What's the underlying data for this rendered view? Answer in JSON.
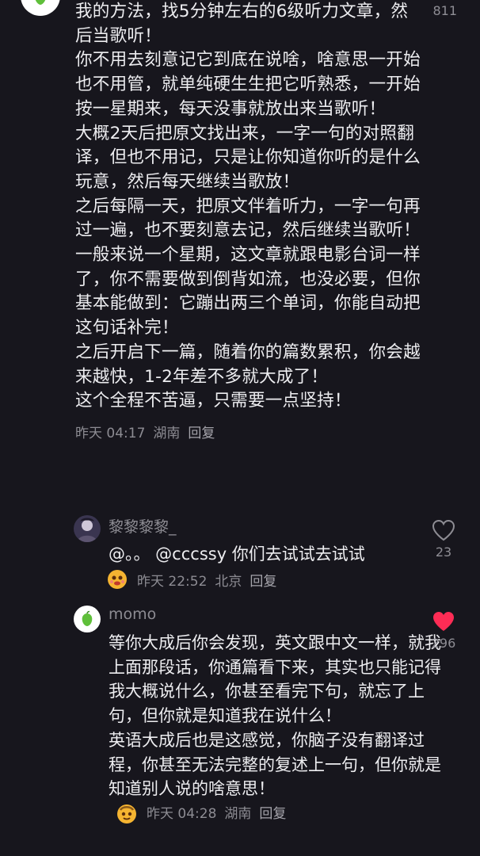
{
  "top": {
    "like_count": "811"
  },
  "main_comment": {
    "paragraphs": [
      "我的方法，找5分钟左右的6级听力文章，然后当歌听！",
      "你不用去刻意记它到底在说啥，啥意思一开始也不用管，就单纯硬生生把它听熟悉，一开始按一星期来，每天没事就放出来当歌听！",
      "大概2天后把原文找出来，一字一句的对照翻译，但也不用记，只是让你知道你听的是什么玩意，然后每天继续当歌放！",
      "之后每隔一天，把原文伴着听力，一字一句再过一遍，也不要刻意去记，然后继续当歌听！",
      "一般来说一个星期，这文章就跟电影台词一样了，你不需要做到倒背如流，也没必要，但你基本能做到：它蹦出两三个单词，你能自动把这句话补完！",
      "之后开启下一篇，随着你的篇数累积，你会越来越快，1-2年差不多就大成了！",
      "这个全程不苦逼，只需要一点坚持！"
    ],
    "time": "昨天 04:17",
    "location": "湖南",
    "reply_label": "回复"
  },
  "replies": [
    {
      "name": "黎黎黎黎_",
      "body": "@。。 @cccssy 你们去试试去试试",
      "time": "昨天 22:52",
      "location": "北京",
      "reply_label": "回复",
      "like_count": "23",
      "liked": false
    },
    {
      "name": "momo",
      "body_paragraphs": [
        "等你大成后你会发现，英文跟中文一样，就我上面那段话，你通篇看下来，其实也只能记得我大概说什么，你甚至看完下句，就忘了上句，但你就是知道我在说什么！",
        "英语大成后也是这感觉，你脑子没有翻译过程，你甚至无法完整的复述上一句，但你就是知道别人说的啥意思！"
      ],
      "time": "昨天 04:28",
      "location": "湖南",
      "reply_label": "回复",
      "like_count": "296",
      "liked": true
    }
  ],
  "colors": {
    "heart_liked": "#fe2c55",
    "heart_outline": "#8e8d94",
    "avatar_green": "#5fbf3a"
  },
  "icons": {
    "heart": "heart-icon",
    "emoji": "emoji-face-icon"
  }
}
